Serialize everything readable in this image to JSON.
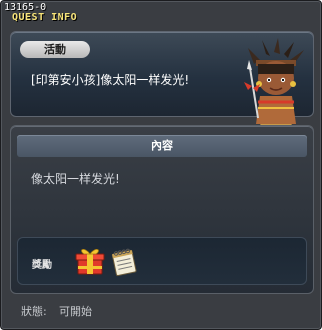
{
  "window": {
    "quest_id": "13165-0",
    "title": "QUEST INFO"
  },
  "quest": {
    "badge": "活動",
    "name": "[印第安小孩]像太阳一样发光!",
    "npc_icon": "indian-child-npc-icon"
  },
  "content": {
    "header": "內容",
    "text": "像太阳一样发光!"
  },
  "reward": {
    "label": "獎勵",
    "items": [
      {
        "icon": "gift-box-icon"
      },
      {
        "icon": "notebook-icon"
      }
    ]
  },
  "status": {
    "label": "狀態:",
    "value": "可開始"
  },
  "colors": {
    "title": "#f7e47a",
    "panel_top": "#3e4a57",
    "panel_bottom": "#1d2632",
    "header": "#5f6c7c"
  }
}
